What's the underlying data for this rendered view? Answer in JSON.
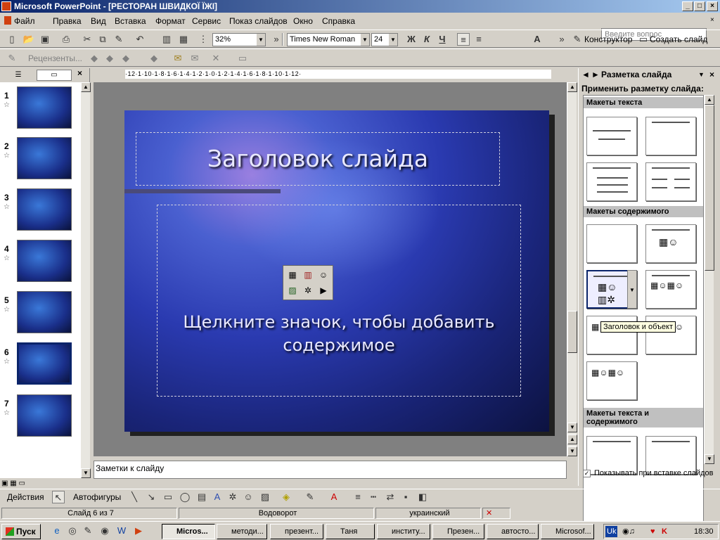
{
  "window": {
    "title": "Microsoft PowerPoint - [РЕСТОРАН ШВИДКОЇ ЇЖІ]",
    "min": "_",
    "max": "□",
    "close": "×"
  },
  "menu": {
    "items": [
      "Файл",
      "Правка",
      "Вид",
      "Вставка",
      "Формат",
      "Сервис",
      "Показ слайдов",
      "Окно",
      "Справка"
    ],
    "help_placeholder": "Введите вопрос"
  },
  "toolbar": {
    "zoom": "32%",
    "font": "Times New Roman",
    "size": "24",
    "bold": "Ж",
    "italic": "К",
    "underline": "Ч",
    "designer": "Конструктор",
    "new_slide": "Создать слайд",
    "review": "Рецензенты..."
  },
  "slide": {
    "title": "Заголовок слайда",
    "body": "Щелкните значок, чтобы добавить содержимое"
  },
  "thumbs": {
    "numbers": [
      "1",
      "2",
      "3",
      "4",
      "5",
      "6",
      "7"
    ]
  },
  "notes": "Заметки к слайду",
  "ruler": {
    "h": "·12·1·10·1·8·1·6·1·4·1·2·1·0·1·2·1·4·1·6·1·8·1·10·1·12·"
  },
  "taskpane": {
    "title": "Разметка слайда",
    "apply": "Применить разметку слайда:",
    "sec1": "Макеты текста",
    "sec2": "Макеты содержимого",
    "sec3": "Макеты текста и содержимого",
    "show_on_insert": "Показывать при вставке слайдов",
    "tooltip": "Заголовок и объект"
  },
  "drawing": {
    "actions": "Действия",
    "autoshapes": "Автофигуры"
  },
  "status": {
    "slide": "Слайд 6 из 7",
    "design": "Водоворот",
    "lang": "украинский"
  },
  "taskbar": {
    "start": "Пуск",
    "tasks": [
      "Micros...",
      "методи...",
      "презент...",
      "Таня",
      "институ...",
      "Презен...",
      "автосто...",
      "Microsof..."
    ],
    "time": "18:30",
    "tray_text": "Uk"
  }
}
